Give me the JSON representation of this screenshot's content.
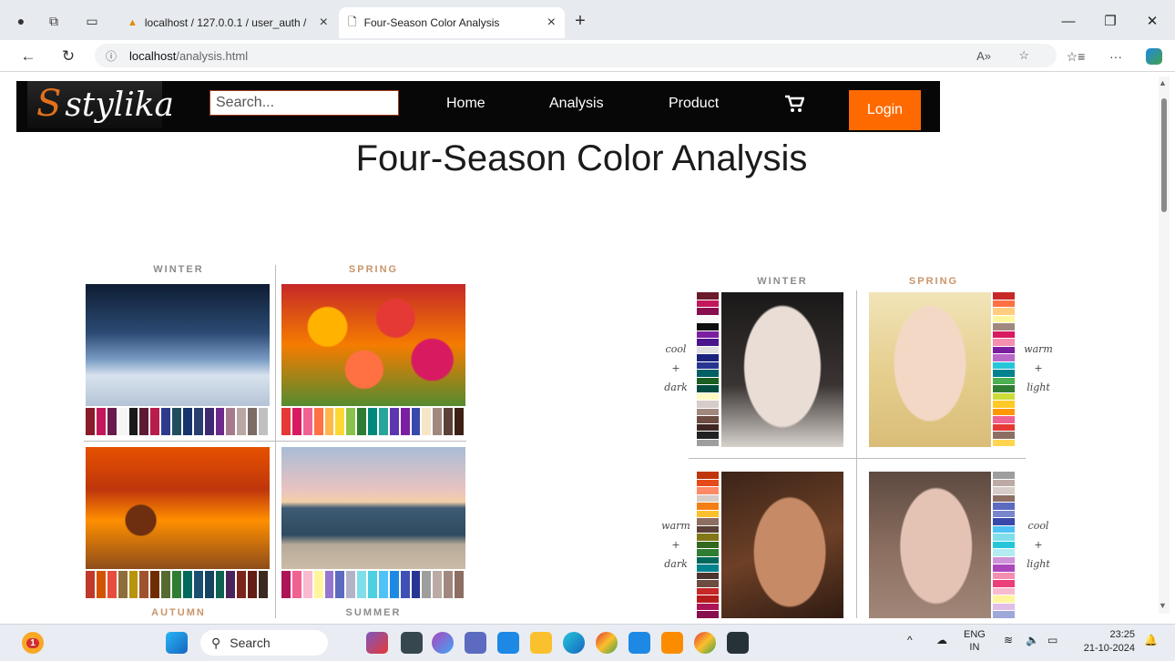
{
  "browser": {
    "tabs": [
      {
        "label": "localhost / 127.0.0.1 / user_auth /",
        "active": false
      },
      {
        "label": "Four-Season Color Analysis",
        "active": true
      }
    ],
    "url_host": "localhost",
    "url_path": "/analysis.html"
  },
  "site": {
    "logo_text": "stylika",
    "search_placeholder": "Search...",
    "nav": [
      "Home",
      "Analysis",
      "Product"
    ],
    "login_label": "Login",
    "accent_color": "#ff6a00"
  },
  "page": {
    "title": "Four-Season Color Analysis",
    "collage": {
      "labels": {
        "top_left": "WINTER",
        "top_right": "SPRING",
        "bottom_left": "AUTUMN",
        "bottom_right": "SUMMER"
      },
      "label_colors": {
        "winter": "#8c8c8c",
        "spring": "#c8956b",
        "autumn": "#c8956b",
        "summer": "#8c8c8c"
      },
      "palettes": {
        "winter": [
          "#8b1a2b",
          "#c2185b",
          "#6a1b4d",
          "#f5f5f5",
          "#1a1a1a",
          "#5c1a33",
          "#b71c4a",
          "#2e3b8c",
          "#1f4e5f",
          "#16336b",
          "#28406f",
          "#3e2a70",
          "#6b2a8c",
          "#a57b8c",
          "#b9a7a3",
          "#7d6b66",
          "#c0c0c0"
        ],
        "spring": [
          "#e53935",
          "#d81b60",
          "#f06292",
          "#ff7043",
          "#ffb74d",
          "#fdd835",
          "#8bc34a",
          "#2e7d32",
          "#00897b",
          "#26a69a",
          "#5e35b1",
          "#7b1fa2",
          "#3949ab",
          "#f5e6c8",
          "#a1887f",
          "#5d4037",
          "#3e1f15"
        ],
        "autumn": [
          "#c0392b",
          "#d35400",
          "#e74c3c",
          "#8e6e3c",
          "#b7950b",
          "#a0522d",
          "#6e2c00",
          "#556b2f",
          "#2e7d32",
          "#00695c",
          "#1b4f72",
          "#154360",
          "#0e6251",
          "#4a235a",
          "#7b241c",
          "#641e16",
          "#3b2a1f"
        ],
        "summer": [
          "#ad1457",
          "#f06292",
          "#f8bbd0",
          "#fff59d",
          "#9575cd",
          "#5c6bc0",
          "#b3b3c8",
          "#80deea",
          "#4dd0e1",
          "#4fc3f7",
          "#1e88e5",
          "#3f51b5",
          "#283593",
          "#9e9e9e",
          "#bcaaa4",
          "#a1887f",
          "#8d6e63"
        ]
      }
    },
    "chart": {
      "labels": {
        "top_left": "WINTER",
        "top_right": "SPRING"
      },
      "descriptors": {
        "winter": [
          "cool",
          "+",
          "dark"
        ],
        "spring": [
          "warm",
          "+",
          "light"
        ],
        "autumn": [
          "warm",
          "+",
          "dark"
        ],
        "summer": [
          "cool",
          "+",
          "light"
        ]
      },
      "strips": {
        "winter": [
          "#6a1b2a",
          "#c2185b",
          "#880e4f",
          "#f8f8f8",
          "#0d0d0d",
          "#7b1fa2",
          "#4a148c",
          "#e0e0e0",
          "#1a237e",
          "#283593",
          "#006064",
          "#1b5e20",
          "#004d40",
          "#fff9c4",
          "#d7ccc8",
          "#a1887f",
          "#6d4c41",
          "#3e2723",
          "#212121",
          "#9e9e9e"
        ],
        "spring": [
          "#c62828",
          "#ff7043",
          "#ffcc80",
          "#fff59d",
          "#a1887f",
          "#d81b60",
          "#f48fb1",
          "#7b1fa2",
          "#ba68c8",
          "#26c6da",
          "#00838f",
          "#4caf50",
          "#2e7d32",
          "#cddc39",
          "#ffca28",
          "#ff9800",
          "#f06292",
          "#e53935",
          "#8d6e63",
          "#ffd54f"
        ],
        "autumn": [
          "#bf360c",
          "#e64a19",
          "#ff8a65",
          "#d7ccc8",
          "#f57f17",
          "#fbc02d",
          "#8d6e63",
          "#5d4037",
          "#827717",
          "#33691e",
          "#2e7d32",
          "#00695c",
          "#00838f",
          "#4e342e",
          "#6d4c41",
          "#c62828",
          "#b71c1c",
          "#ad1457",
          "#880e4f",
          "#3e2723"
        ],
        "summer": [
          "#9e9e9e",
          "#bcaaa4",
          "#d7ccc8",
          "#8d6e63",
          "#5c6bc0",
          "#7986cb",
          "#3949ab",
          "#4fc3f7",
          "#80deea",
          "#26c6da",
          "#b2ebf2",
          "#ce93d8",
          "#ab47bc",
          "#f48fb1",
          "#ec407a",
          "#f8bbd0",
          "#fff59d",
          "#e1bee7",
          "#9fa8da",
          "#78909c"
        ]
      }
    }
  },
  "taskbar": {
    "search_label": "Search",
    "lang_top": "ENG",
    "lang_bottom": "IN",
    "time": "23:25",
    "date": "21-10-2024",
    "badge": "1"
  }
}
